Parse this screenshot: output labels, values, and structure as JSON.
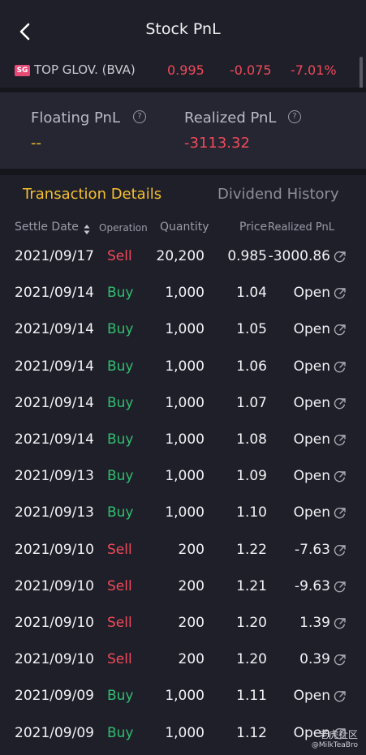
{
  "header": {
    "title": "Stock PnL"
  },
  "stock": {
    "market_badge": "SG",
    "name": "TOP GLOV. (BVA)",
    "price": "0.995",
    "change": "-0.075",
    "change_pct": "-7.01%"
  },
  "pnl": {
    "floating_label": "Floating PnL",
    "floating_value": "--",
    "realized_label": "Realized PnL",
    "realized_value": "-3113.32"
  },
  "tabs": {
    "transaction_details": "Transaction Details",
    "dividend_history": "Dividend History"
  },
  "table": {
    "columns": {
      "settle_date": "Settle Date",
      "operation": "Operation",
      "quantity": "Quantity",
      "price": "Price",
      "realized_pnl": "Realized PnL"
    },
    "rows": [
      {
        "date": "2021/09/17",
        "op": "Sell",
        "qty": "20,200",
        "price": "0.985",
        "rpnl": "-3000.86"
      },
      {
        "date": "2021/09/14",
        "op": "Buy",
        "qty": "1,000",
        "price": "1.04",
        "rpnl": "Open"
      },
      {
        "date": "2021/09/14",
        "op": "Buy",
        "qty": "1,000",
        "price": "1.05",
        "rpnl": "Open"
      },
      {
        "date": "2021/09/14",
        "op": "Buy",
        "qty": "1,000",
        "price": "1.06",
        "rpnl": "Open"
      },
      {
        "date": "2021/09/14",
        "op": "Buy",
        "qty": "1,000",
        "price": "1.07",
        "rpnl": "Open"
      },
      {
        "date": "2021/09/14",
        "op": "Buy",
        "qty": "1,000",
        "price": "1.08",
        "rpnl": "Open"
      },
      {
        "date": "2021/09/13",
        "op": "Buy",
        "qty": "1,000",
        "price": "1.09",
        "rpnl": "Open"
      },
      {
        "date": "2021/09/13",
        "op": "Buy",
        "qty": "1,000",
        "price": "1.10",
        "rpnl": "Open"
      },
      {
        "date": "2021/09/10",
        "op": "Sell",
        "qty": "200",
        "price": "1.22",
        "rpnl": "-7.63"
      },
      {
        "date": "2021/09/10",
        "op": "Sell",
        "qty": "200",
        "price": "1.21",
        "rpnl": "-9.63"
      },
      {
        "date": "2021/09/10",
        "op": "Sell",
        "qty": "200",
        "price": "1.20",
        "rpnl": "1.39"
      },
      {
        "date": "2021/09/10",
        "op": "Sell",
        "qty": "200",
        "price": "1.20",
        "rpnl": "0.39"
      },
      {
        "date": "2021/09/09",
        "op": "Buy",
        "qty": "1,000",
        "price": "1.11",
        "rpnl": "Open"
      },
      {
        "date": "2021/09/09",
        "op": "Buy",
        "qty": "1,000",
        "price": "1.12",
        "rpnl": "Open"
      }
    ]
  },
  "watermark": {
    "line1": "老虎社区",
    "line2": "@MilkTeaBro"
  },
  "colors": {
    "sell": "#f04a5a",
    "buy": "#2fbf71",
    "accent": "#f5c02e",
    "negative": "#f04a5a"
  },
  "icons": {
    "back": "chevron-left-icon",
    "help": "question-circle-icon",
    "sort": "sort-arrows-icon",
    "link": "external-link-icon"
  }
}
